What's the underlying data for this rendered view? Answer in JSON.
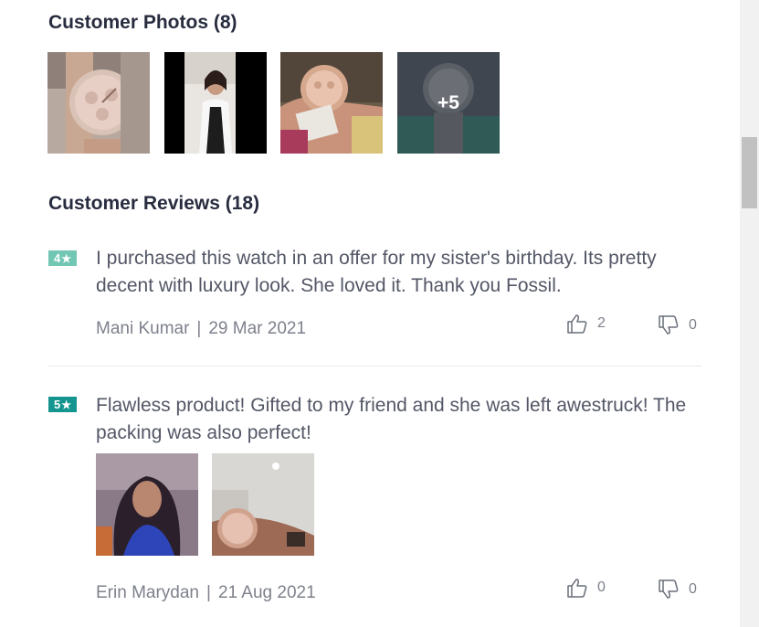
{
  "photos": {
    "title": "Customer Photos (8)",
    "items": [
      {
        "name": "watch-photo-1"
      },
      {
        "name": "customer-photo-2"
      },
      {
        "name": "watch-in-hand-photo-3"
      },
      {
        "name": "watch-photo-4"
      }
    ],
    "more_label": "+5"
  },
  "reviews": {
    "title": "Customer Reviews (18)",
    "items": [
      {
        "rating": "4",
        "rating_color": "#72c6b4",
        "text": "I purchased this watch in an offer for my sister's birthday. Its pretty decent with luxury look. She loved it. Thank you Fossil.",
        "author": "Mani Kumar",
        "date": "29 Mar 2021",
        "likes": "2",
        "dislikes": "0"
      },
      {
        "rating": "5",
        "rating_color": "#14958f",
        "text": "Flawless product! Gifted to my friend and she was left awestruck! The packing was also perfect!",
        "author": "Erin Marydan",
        "date": "21 Aug 2021",
        "likes": "0",
        "dislikes": "0"
      }
    ]
  },
  "icons": {
    "star": "★",
    "like": "thumbs-up-icon",
    "dislike": "thumbs-down-icon"
  }
}
